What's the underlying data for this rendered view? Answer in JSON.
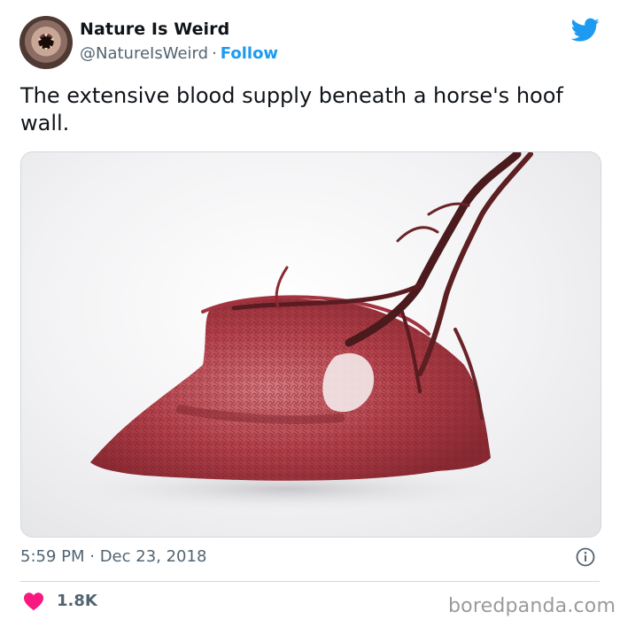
{
  "author": {
    "name": "Nature Is Weird",
    "handle": "@NatureIsWeird",
    "separator": "·",
    "follow_label": "Follow"
  },
  "tweet": {
    "text": "The extensive blood supply beneath a horse's hoof wall.",
    "timestamp": "5:59 PM · Dec 23, 2018"
  },
  "engagement": {
    "likes": "1.8K"
  },
  "watermark": "boredpanda.com",
  "icons": {
    "platform": "twitter-bird-icon",
    "info": "info-icon",
    "like": "heart-icon"
  },
  "colors": {
    "accent": "#1d9bf0",
    "heart": "#f91880",
    "muted_text": "#536471",
    "border": "#cfd9de"
  }
}
